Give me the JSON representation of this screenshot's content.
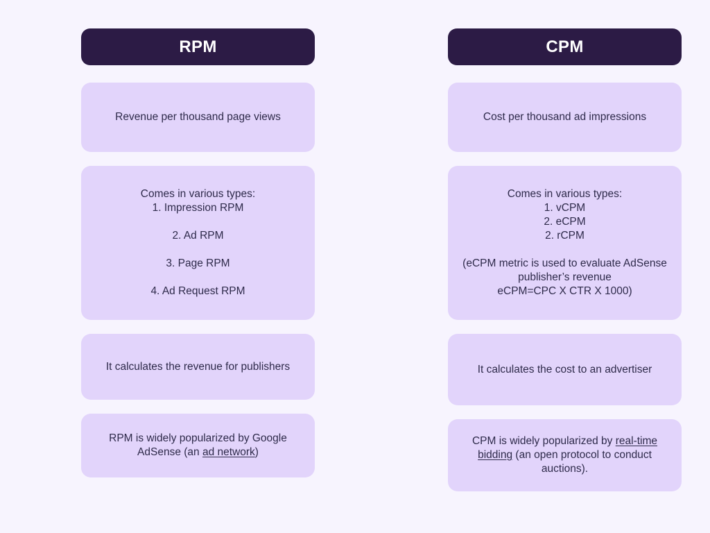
{
  "theme": {
    "page_background": "#f7f4fe",
    "header_background": "#2c1b45",
    "header_text_color": "#ffffff",
    "card_background": "#e2d4fb",
    "card_text_color": "#2e2a4a"
  },
  "columns": {
    "rpm": {
      "header": "RPM",
      "definition": "Revenue per thousand page views",
      "types": "Comes in various types:\n1. Impression RPM\n\n2. Ad RPM\n\n3. Page RPM\n\n4. Ad Request RPM",
      "calculates": "It calculates the revenue for publishers",
      "popularized_prefix": "RPM is widely popularized by Google AdSense (an ",
      "popularized_link": "ad network",
      "popularized_suffix": ")"
    },
    "cpm": {
      "header": "CPM",
      "definition": "Cost per thousand ad impressions",
      "types": "Comes in various types:\n1. vCPM\n2. eCPM\n2. rCPM\n\n(eCPM metric is used to evaluate AdSense publisher’s revenue\neCPM=CPC X CTR X 1000)",
      "calculates": "It calculates the cost to an advertiser",
      "popularized_prefix": "CPM is widely popularized by ",
      "popularized_link": "real-time bidding",
      "popularized_suffix": " (an open protocol to conduct auctions)."
    }
  }
}
